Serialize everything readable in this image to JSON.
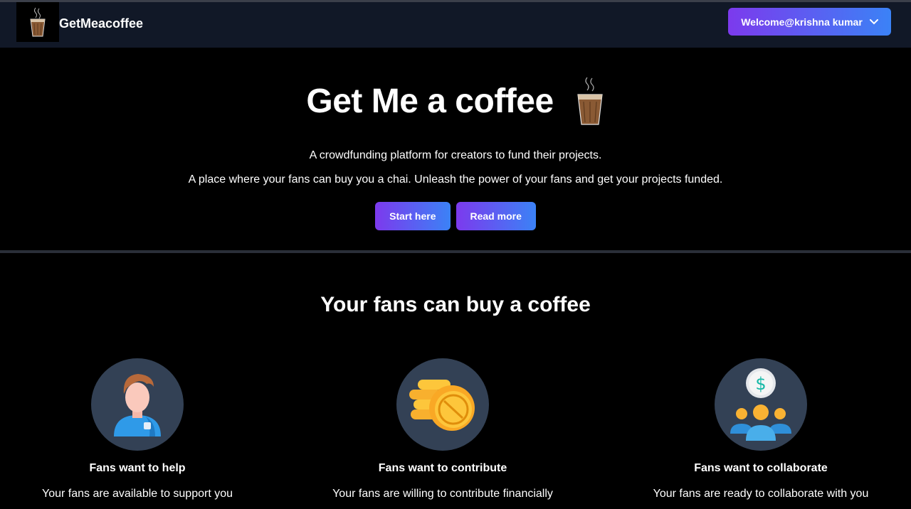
{
  "nav": {
    "brand": "GetMeacoffee",
    "welcome_label": "Welcome@krishna kumar",
    "logo_icon": "tea-glass-icon"
  },
  "hero": {
    "title": "Get Me a coffee",
    "line1": "A crowdfunding platform for creators to fund their projects.",
    "line2": "A place where your fans can buy you a chai. Unleash the power of your fans and get your projects funded.",
    "start_label": "Start here",
    "read_label": "Read more"
  },
  "section": {
    "title": "Your fans can buy a coffee"
  },
  "features": [
    {
      "title": "Fans want to help",
      "desc": "Your fans are available to support you",
      "icon": "person-icon"
    },
    {
      "title": "Fans want to contribute",
      "desc": "Your fans are willing to contribute financially",
      "icon": "coins-icon"
    },
    {
      "title": "Fans want to collaborate",
      "desc": "Your fans are ready to collaborate with you",
      "icon": "group-dollar-icon"
    }
  ],
  "colors": {
    "nav_bg": "#111827",
    "gradient_start": "#7c3aed",
    "gradient_end": "#3b82f6",
    "circle_bg": "#334155"
  }
}
